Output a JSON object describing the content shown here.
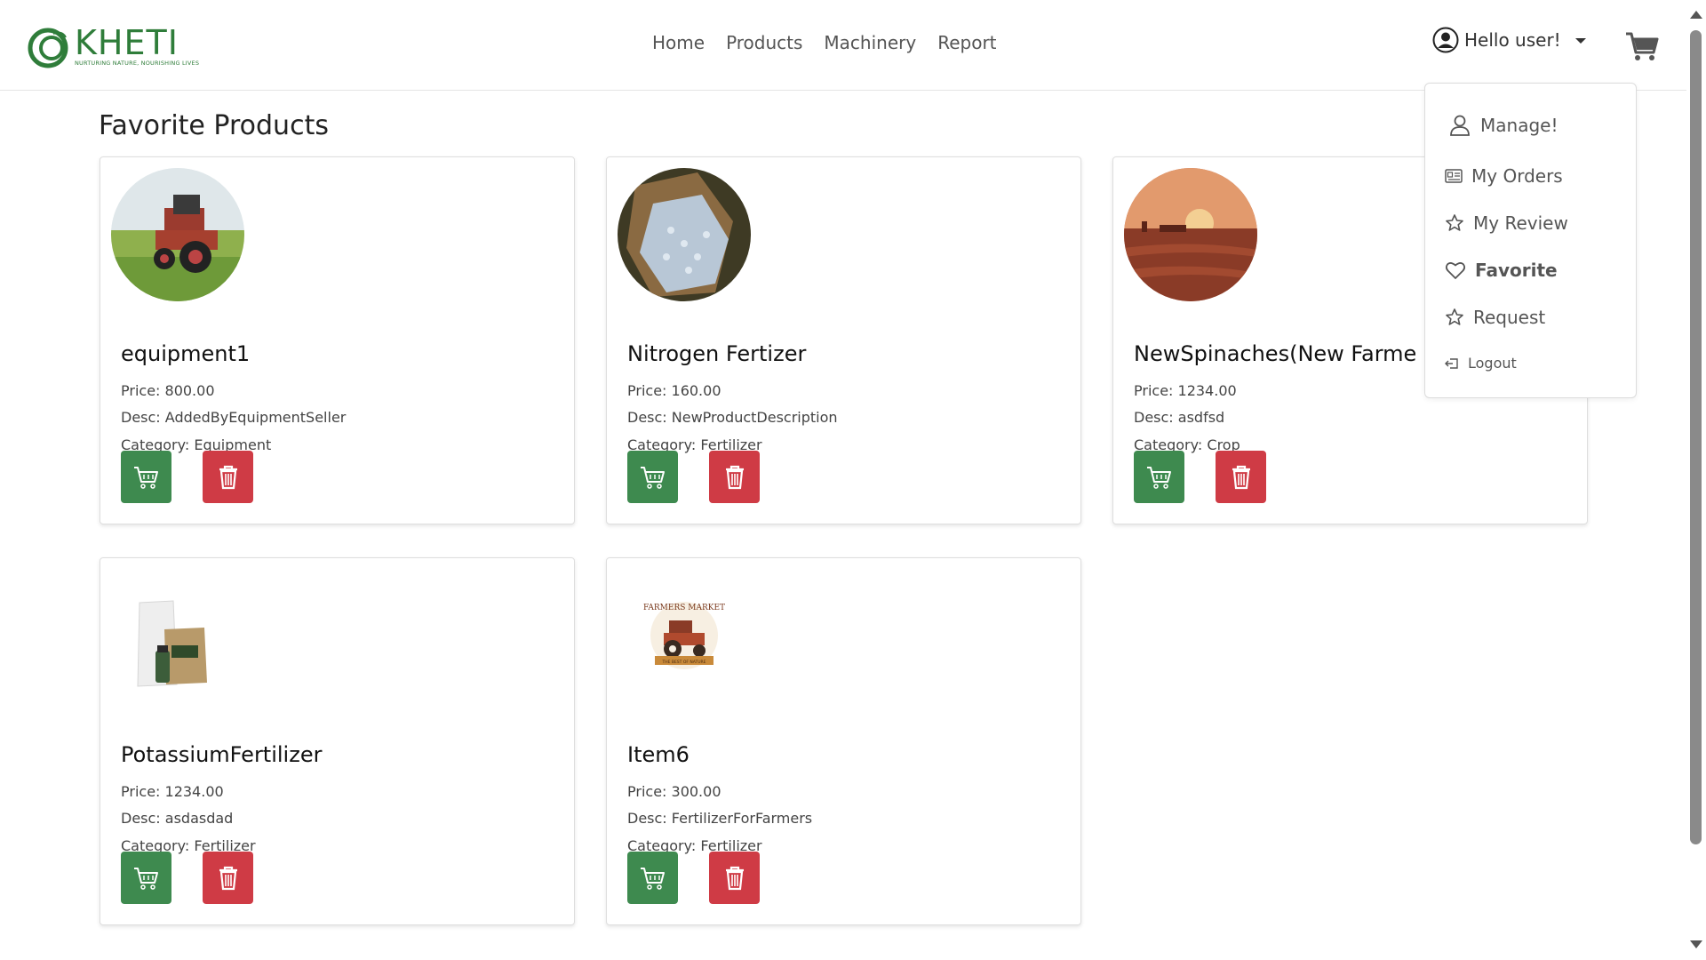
{
  "header": {
    "logo_text": "KHETI",
    "logo_tagline": "NURTURING NATURE, NOURISHING LIVES",
    "nav": [
      "Home",
      "Products",
      "Machinery",
      "Report"
    ],
    "user_label": "Hello user!"
  },
  "dropdown": {
    "items": [
      {
        "label": "Manage!",
        "icon": "person-icon"
      },
      {
        "label": "My Orders",
        "icon": "orders-icon"
      },
      {
        "label": "My Review",
        "icon": "star-icon"
      },
      {
        "label": "Favorite",
        "icon": "heart-icon"
      },
      {
        "label": "Request",
        "icon": "star-icon"
      },
      {
        "label": "Logout",
        "icon": "logout-icon"
      }
    ]
  },
  "page": {
    "title": "Favorite Products"
  },
  "products": [
    {
      "name": "equipment1",
      "price": "Price: 800.00",
      "desc": "Desc: AddedByEquipmentSeller",
      "category": "Category: Equipment",
      "image": "tractor-field-photo"
    },
    {
      "name": "Nitrogen Fertizer",
      "price": "Price: 160.00",
      "desc": "Desc: NewProductDescription",
      "category": "Category: Fertilizer",
      "image": "fertilizer-sack-photo"
    },
    {
      "name": "NewSpinaches(New Farme",
      "price": "Price: 1234.00",
      "desc": "Desc: asdfsd",
      "category": "Category: Crop",
      "image": "sunset-farm-illustration"
    },
    {
      "name": "PotassiumFertilizer",
      "price": "Price: 1234.00",
      "desc": "Desc: asdasdad",
      "category": "Category: Fertilizer",
      "image": "fertilizer-bags-photo"
    },
    {
      "name": "Item6",
      "price": "Price: 300.00",
      "desc": "Desc: FertilizerForFarmers",
      "category": "Category: Fertilizer",
      "image": "farmers-market-logo"
    }
  ],
  "logo_text_farmers": {
    "top": "FARMERS MARKET",
    "bottom": "THE BEST OF NATURE"
  },
  "colors": {
    "brand_green": "#2f7d3a",
    "cart_button": "#3e8a4f",
    "delete_button": "#cf3b45"
  }
}
